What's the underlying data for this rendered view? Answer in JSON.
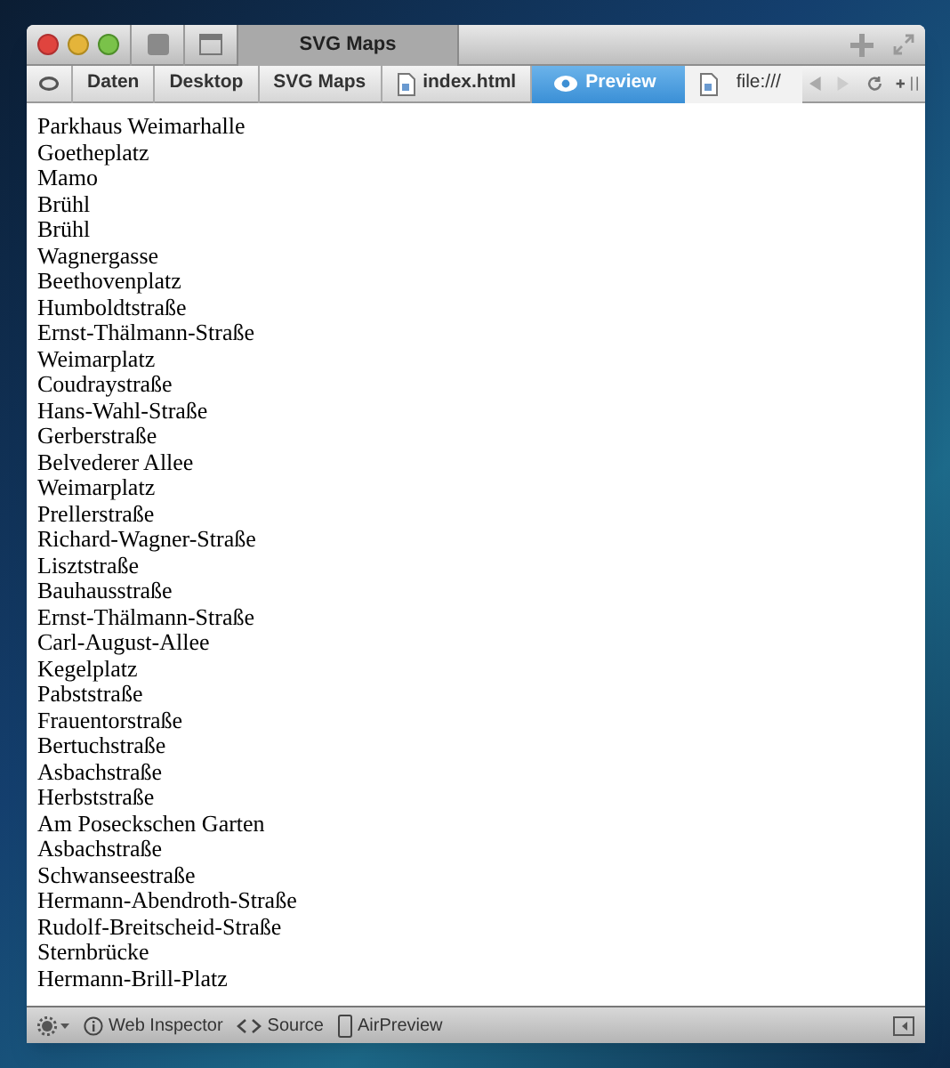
{
  "window": {
    "title": "SVG Maps"
  },
  "breadcrumbs": [
    {
      "label": "Daten",
      "kind": "folder",
      "selected": false
    },
    {
      "label": "Desktop",
      "kind": "folder",
      "selected": false
    },
    {
      "label": "SVG Maps",
      "kind": "folder",
      "selected": false
    },
    {
      "label": "index.html",
      "kind": "file",
      "selected": false
    },
    {
      "label": "Preview",
      "kind": "preview",
      "selected": true
    }
  ],
  "address": {
    "value": "file:///"
  },
  "content": {
    "lines": [
      "Parkhaus Weimarhalle",
      "Goetheplatz",
      "Mamo",
      "Brühl",
      "Brühl",
      "Wagnergasse",
      "Beethovenplatz",
      "Humboldtstraße",
      "Ernst-Thälmann-Straße",
      "Weimarplatz",
      "Coudraystraße",
      "Hans-Wahl-Straße",
      "Gerberstraße",
      "Belvederer Allee",
      "Weimarplatz",
      "Prellerstraße",
      "Richard-Wagner-Straße",
      "Lisztstraße",
      "Bauhausstraße",
      "Ernst-Thälmann-Straße",
      "Carl-August-Allee",
      "Kegelplatz",
      "Pabststraße",
      "Frauentorstraße",
      "Bertuchstraße",
      "Asbachstraße",
      "Herbststraße",
      "Am Poseckschen Garten",
      "Asbachstraße",
      "Schwanseestraße",
      "Hermann-Abendroth-Straße",
      "Rudolf-Breitscheid-Straße",
      "Sternbrücke",
      "Hermann-Brill-Platz"
    ]
  },
  "status_bar": {
    "items": [
      {
        "label": "Web Inspector",
        "kind": "info"
      },
      {
        "label": "Source",
        "kind": "code"
      },
      {
        "label": "AirPreview",
        "kind": "device"
      }
    ]
  }
}
